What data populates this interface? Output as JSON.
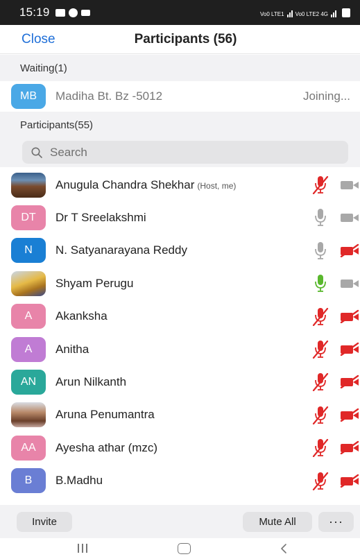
{
  "status_bar": {
    "time": "15:19",
    "sim1_label": "Vo0 LTE1",
    "sim2_label": "Vo0 LTE2 4G"
  },
  "header": {
    "close_label": "Close",
    "title": "Participants (56)"
  },
  "waiting": {
    "section_label": "Waiting(1)",
    "person": {
      "initials": "MB",
      "color": "#4aa8e6",
      "name": "Madiha Bt. Bz -5012",
      "status": "Joining..."
    }
  },
  "participants_section": {
    "label": "Participants(55)"
  },
  "search": {
    "placeholder": "Search"
  },
  "participants": [
    {
      "name": "Anugula Chandra Shekhar",
      "role": "(Host, me)",
      "avatar_type": "photo",
      "photo": "man",
      "mic": "muted",
      "video": "off-grey"
    },
    {
      "name": "Dr T Sreelakshmi",
      "initials": "DT",
      "color": "#e884a9",
      "mic": "unmuted-grey",
      "video": "off-grey"
    },
    {
      "name": "N. Satyanarayana Reddy",
      "initials": "N",
      "color": "#1a7fd4",
      "mic": "unmuted-grey",
      "video": "muted"
    },
    {
      "name": "Shyam Perugu",
      "avatar_type": "photo",
      "photo": "group",
      "mic": "active-green",
      "video": "off-grey"
    },
    {
      "name": "Akanksha",
      "initials": "A",
      "color": "#e884a9",
      "mic": "muted",
      "video": "muted"
    },
    {
      "name": "Anitha",
      "initials": "A",
      "color": "#c07cd4",
      "mic": "muted",
      "video": "muted"
    },
    {
      "name": "Arun Nilkanth",
      "initials": "AN",
      "color": "#2aa89a",
      "mic": "muted",
      "video": "muted"
    },
    {
      "name": "Aruna Penumantra",
      "avatar_type": "photo",
      "photo": "woman",
      "mic": "muted",
      "video": "muted"
    },
    {
      "name": "Ayesha athar (mzc)",
      "initials": "AA",
      "color": "#e884a9",
      "mic": "muted",
      "video": "muted"
    },
    {
      "name": "B.Madhu",
      "initials": "B",
      "color": "#6a7ed4",
      "mic": "muted",
      "video": "muted"
    }
  ],
  "footer": {
    "invite_label": "Invite",
    "mute_all_label": "Mute All",
    "more_label": "···"
  },
  "colors": {
    "accent": "#1f6fd8",
    "muted_red": "#e02828",
    "active_green": "#5ab82e",
    "icon_grey": "#a8a8a8"
  }
}
